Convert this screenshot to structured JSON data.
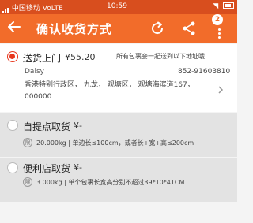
{
  "status_bar": {
    "carrier": "中国移动",
    "network": "VoLTE",
    "time": "10:59"
  },
  "header": {
    "title": "确认收货方式",
    "badge_count": "2"
  },
  "options": [
    {
      "title": "送货上门",
      "price": "¥55.20",
      "selected": true,
      "note": "所有包裹会一起送到以下地址哦",
      "name": "Daisy",
      "phone": "852-91603810",
      "address": "香港特别行政区， 九龙， 观塘区， 观塘海滨道167， 000000"
    },
    {
      "title": "自提点取货",
      "price": "¥-",
      "selected": false,
      "limit_icon": "限",
      "spec": "20.000kg | 单边长≤100cm，或者长+宽+高≤200cm"
    },
    {
      "title": "便利店取货",
      "price": "¥-",
      "selected": false,
      "limit_icon": "限",
      "spec": "3.000kg | 单个包裹长宽高分别不超过39*10*41CM"
    }
  ],
  "colors": {
    "accent": "#f26c2a",
    "status_bar": "#d84e1e",
    "radio_selected": "#e8361c"
  }
}
